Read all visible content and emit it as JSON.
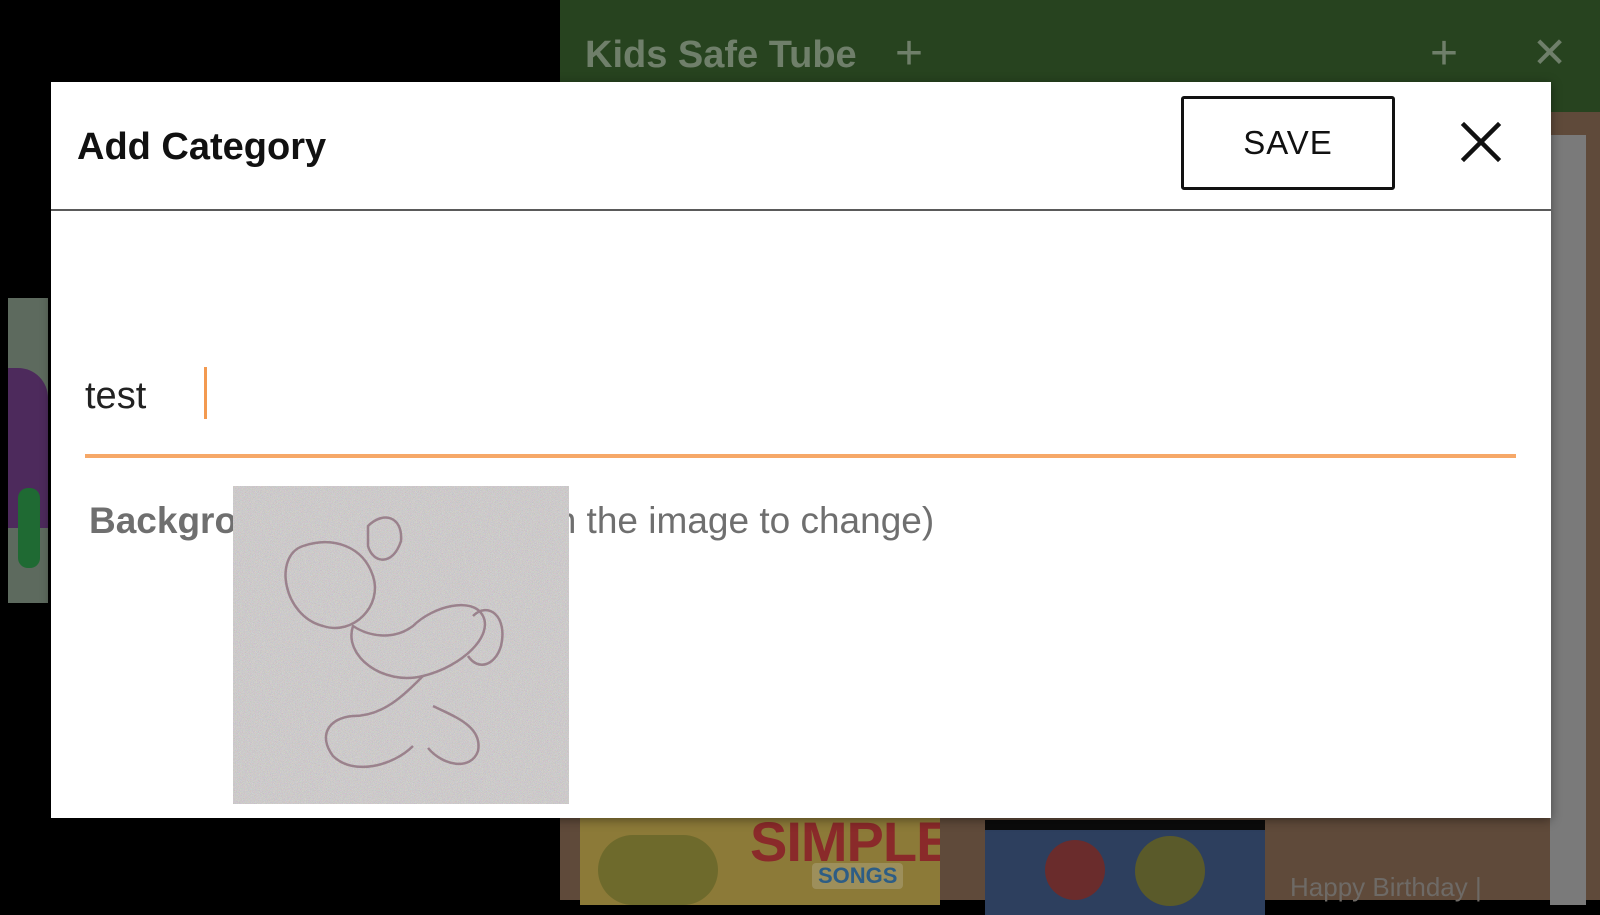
{
  "app": {
    "title": "Kids Safe Tube",
    "thumbnail_text": "SIMPLE",
    "thumbnail_subtext": "SONGS",
    "video_caption": "Happy Birthday |"
  },
  "dialog": {
    "title": "Add Category",
    "save_label": "SAVE",
    "name_value": "test",
    "background_label_bold": "Background Image",
    "background_label_hint": "(Click on the image to change)"
  },
  "colors": {
    "toolbar": "#27431f",
    "accent_underline": "#f6a868",
    "dialog_bg": "#ffffff"
  },
  "icons": {
    "close": "close-icon",
    "add": "plus-icon",
    "image": "character-image"
  }
}
